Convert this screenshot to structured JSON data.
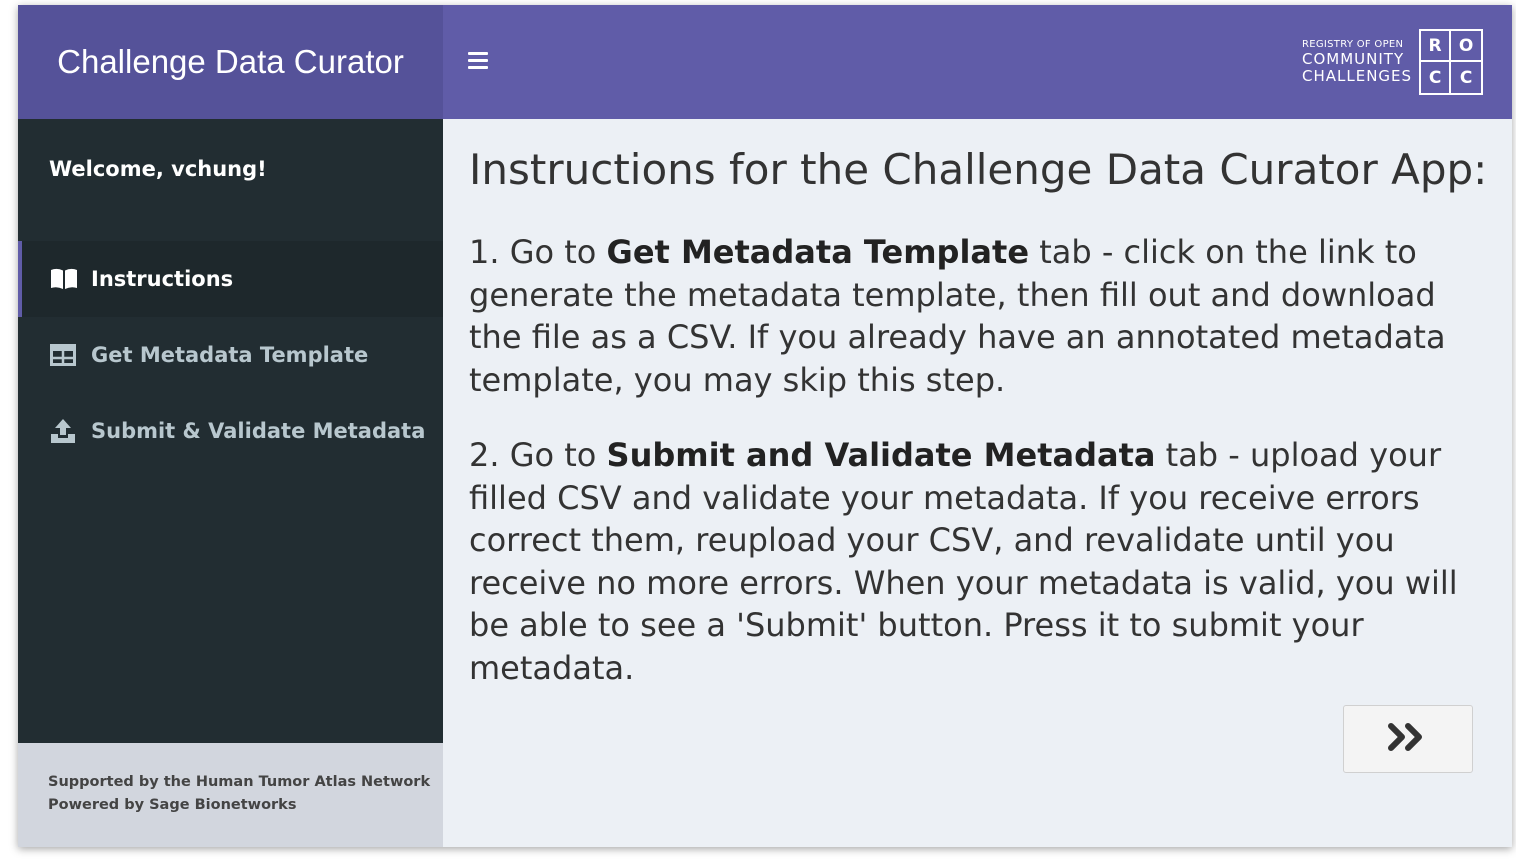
{
  "header": {
    "app_title": "Challenge Data Curator",
    "menu_icon": "hamburger-icon",
    "brand": {
      "line1": "REGISTRY OF OPEN",
      "line2": "COMMUNITY",
      "line3": "CHALLENGES",
      "letters": [
        "R",
        "O",
        "C",
        "C"
      ]
    }
  },
  "sidebar": {
    "welcome": "Welcome, vchung!",
    "items": [
      {
        "label": "Instructions",
        "icon": "book-icon",
        "active": true
      },
      {
        "label": "Get Metadata Template",
        "icon": "table-icon",
        "active": false
      },
      {
        "label": "Submit & Validate Metadata",
        "icon": "upload-icon",
        "active": false
      }
    ],
    "footer": {
      "line1": "Supported by the Human Tumor Atlas Network",
      "line2": "Powered by Sage Bionetworks"
    }
  },
  "main": {
    "title": "Instructions for the Challenge Data Curator App:",
    "step1": {
      "prefix": "1. Go to ",
      "bold": "Get Metadata Template",
      "suffix": " tab - click on the link to generate the metadata template, then fill out and download the file as a CSV. If you already have an annotated metadata template, you may skip this step."
    },
    "step2": {
      "prefix": "2. Go to ",
      "bold": "Submit and Validate Metadata",
      "suffix": " tab - upload your filled CSV and validate your metadata. If you receive errors correct them, reupload your CSV, and revalidate until you receive no more errors. When your metadata is valid, you will be able to see a 'Submit' button. Press it to submit your metadata."
    },
    "next_button_icon": "double-chevron-right-icon"
  },
  "colors": {
    "header": "#605ca8",
    "logo_bg": "#555299",
    "sidebar": "#222d32",
    "sidebar_active": "#1e282c",
    "content_bg": "#ecf0f5",
    "footer_bg": "#d2d6de"
  }
}
